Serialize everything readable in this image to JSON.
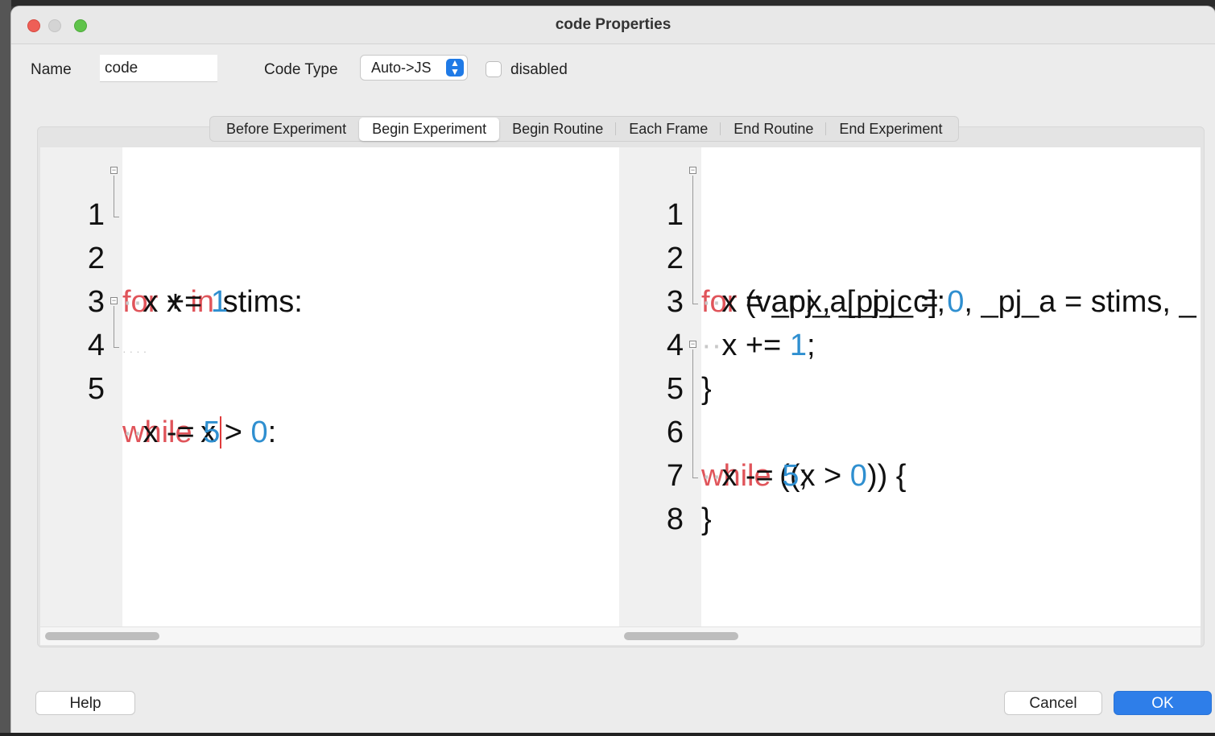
{
  "window": {
    "title": "code Properties"
  },
  "form": {
    "name_label": "Name",
    "name_value": "code",
    "code_type_label": "Code Type",
    "code_type_value": "Auto->JS",
    "disabled_label": "disabled",
    "disabled_checked": false
  },
  "tabs": [
    {
      "label": "Before Experiment",
      "active": false
    },
    {
      "label": "Begin Experiment",
      "active": true
    },
    {
      "label": "Begin Routine",
      "active": false
    },
    {
      "label": "Each Frame",
      "active": false
    },
    {
      "label": "End Routine",
      "active": false
    },
    {
      "label": "End Experiment",
      "active": false
    }
  ],
  "editors": {
    "python": {
      "line_numbers": [
        "1",
        "2",
        "3",
        "4",
        "5"
      ],
      "lines": [
        {
          "kw1": "for",
          "t1": " x ",
          "kw2": "in",
          "t2": " stims:"
        },
        {
          "t1": "x += ",
          "n1": "1"
        },
        {
          "t1": ""
        },
        {
          "kw1": "while",
          "t1": " x > ",
          "n1": "0",
          "t2": ":"
        },
        {
          "t1": "x -= ",
          "n1": "5"
        }
      ]
    },
    "javascript": {
      "line_numbers": [
        "1",
        "2",
        "3",
        "4",
        "5",
        "6",
        "7",
        "8"
      ],
      "lines": [
        {
          "kw1": "for",
          "t1": " (var x, _pj_c = ",
          "n1": "0",
          "t2": ", _pj_a = stims, _"
        },
        {
          "t1": "x = _pj_a[_pj_c];"
        },
        {
          "t1": "x += ",
          "n1": "1",
          "t2": ";"
        },
        {
          "t1": "}"
        },
        {
          "kw1": "while",
          "t1": " ((x > ",
          "n1": "0",
          "t2": ")) {"
        },
        {
          "t1": "x -= ",
          "n1": "5",
          "t2": ";"
        },
        {
          "t1": "}"
        },
        {
          "t1": ""
        }
      ]
    }
  },
  "buttons": {
    "help": "Help",
    "cancel": "Cancel",
    "ok": "OK"
  },
  "colors": {
    "keyword": "#e0545a",
    "number": "#2f8fd0",
    "ok_button": "#2e7ee9"
  }
}
